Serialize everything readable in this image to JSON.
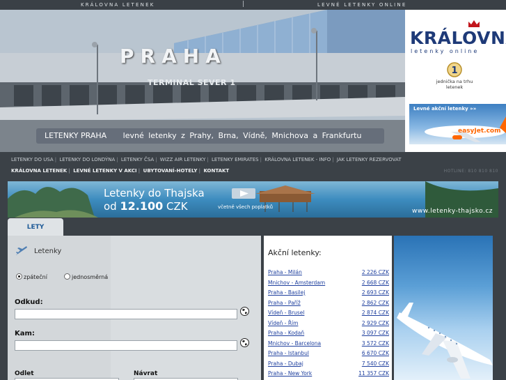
{
  "topbar": {
    "left": "KRÁLOVNA LETENEK",
    "separator": "|",
    "right": "LEVNÉ LETENKY ONLINE"
  },
  "hero": {
    "city": "PRAHA",
    "terminal": "TERMINAL SEVER 1",
    "caption_title": "LETENKY PRAHA",
    "caption_text": "levné letenky z Prahy, Brna, Vídně, Mnichova a Frankfurtu"
  },
  "logo": {
    "brand": "KRÁLOVNA",
    "tagline": "letenky online",
    "badge_number": "1",
    "badge_text": "jednička na trhu letenek",
    "promo_text": "Levné akční letenky »»",
    "promo_brand": "easyJet.com"
  },
  "nav": {
    "row1": [
      "LETENKY DO USA",
      "LETENKY DO LONDÝNA",
      "LETENKY ČSA",
      "WIZZ AIR LETENKY",
      "LETENKY EMIRATES",
      "KRÁLOVNA LETENEK - INFO",
      "JAK LETENKY REZERVOVAT"
    ],
    "row2": [
      "KRÁLOVNA LETENEK",
      "LEVNÉ LETENKY V AKCI",
      "UBYTOVANÍ-HOTELY",
      "KONTAKT"
    ],
    "hotline": "HOTLINE: 810 810 810"
  },
  "banner": {
    "line1": "Letenky do Thajska",
    "line2_prefix": "od",
    "line2_price": "12.100",
    "line2_currency": "CZK",
    "line2_note": "včetně všech poplatků",
    "url": "www.letenky-thajsko.cz"
  },
  "tab": {
    "label": "LETY"
  },
  "form": {
    "heading": "Letenky",
    "radio_return": "zpáteční",
    "radio_oneway": "jednosměrná",
    "from_label": "Odkud:",
    "to_label": "Kam:",
    "depart_label": "Odlet",
    "return_label": "Návrat",
    "from_value": "",
    "to_value": ""
  },
  "deals": {
    "title": "Akční letenky:",
    "items": [
      {
        "route": "Praha - Milán",
        "price": "2 226 CZK"
      },
      {
        "route": "Mnichov - Amsterdam",
        "price": "2 668 CZK"
      },
      {
        "route": "Praha - Basilej",
        "price": "2 693 CZK"
      },
      {
        "route": "Praha - Paříž",
        "price": "2 862 CZK"
      },
      {
        "route": "Vídeň - Brusel",
        "price": "2 874 CZK"
      },
      {
        "route": "Vídeň - Řím",
        "price": "2 929 CZK"
      },
      {
        "route": "Praha - Kodaň",
        "price": "3 097 CZK"
      },
      {
        "route": "Mnichov - Barcelona",
        "price": "3 572 CZK"
      },
      {
        "route": "Praha - Istanbul",
        "price": "6 670 CZK"
      },
      {
        "route": "Praha - Dubaj",
        "price": "7 540 CZK"
      },
      {
        "route": "Praha - New York",
        "price": "11 357 CZK"
      }
    ]
  },
  "colors": {
    "background": "#3b4147",
    "brand_blue": "#1e3a78",
    "link_blue": "#1e3f9e",
    "panel": "#d9dde0"
  }
}
